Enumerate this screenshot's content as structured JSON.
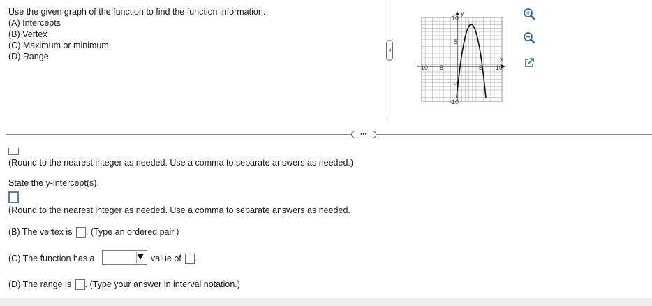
{
  "prompt": {
    "intro": "Use the given graph of the function to find the function information.",
    "items": [
      "(A) Intercepts",
      "(B) Vertex",
      "(C) Maximum or minimum",
      "(D) Range"
    ]
  },
  "graph": {
    "y_axis_label": "y",
    "x_axis_label": "x",
    "x_ticks": [
      "-10",
      "-5",
      "5",
      "10"
    ],
    "y_ticks": [
      "10",
      "5",
      "-5",
      "-10"
    ]
  },
  "tools": {
    "zoom_in": "zoom-in-icon",
    "zoom_out": "zoom-out-icon",
    "popout": "external-link-icon"
  },
  "answers": {
    "round_note_1": "(Round to the nearest integer as needed. Use a comma to separate answers as needed.)",
    "y_intercept_label": "State the y-intercept(s).",
    "round_note_2": "(Round to the nearest integer as needed. Use a comma to separate answers as needed.",
    "vertex_label": "(B) The vertex is",
    "vertex_hint": ". (Type an ordered pair.)",
    "function_has_label": "(C) The function has a",
    "value_of_label": "value of",
    "range_label": "(D) The range is",
    "range_hint": ". (Type your answer in interval notation.)"
  },
  "colors": {
    "input_focus_border": "#5b7ea6"
  }
}
